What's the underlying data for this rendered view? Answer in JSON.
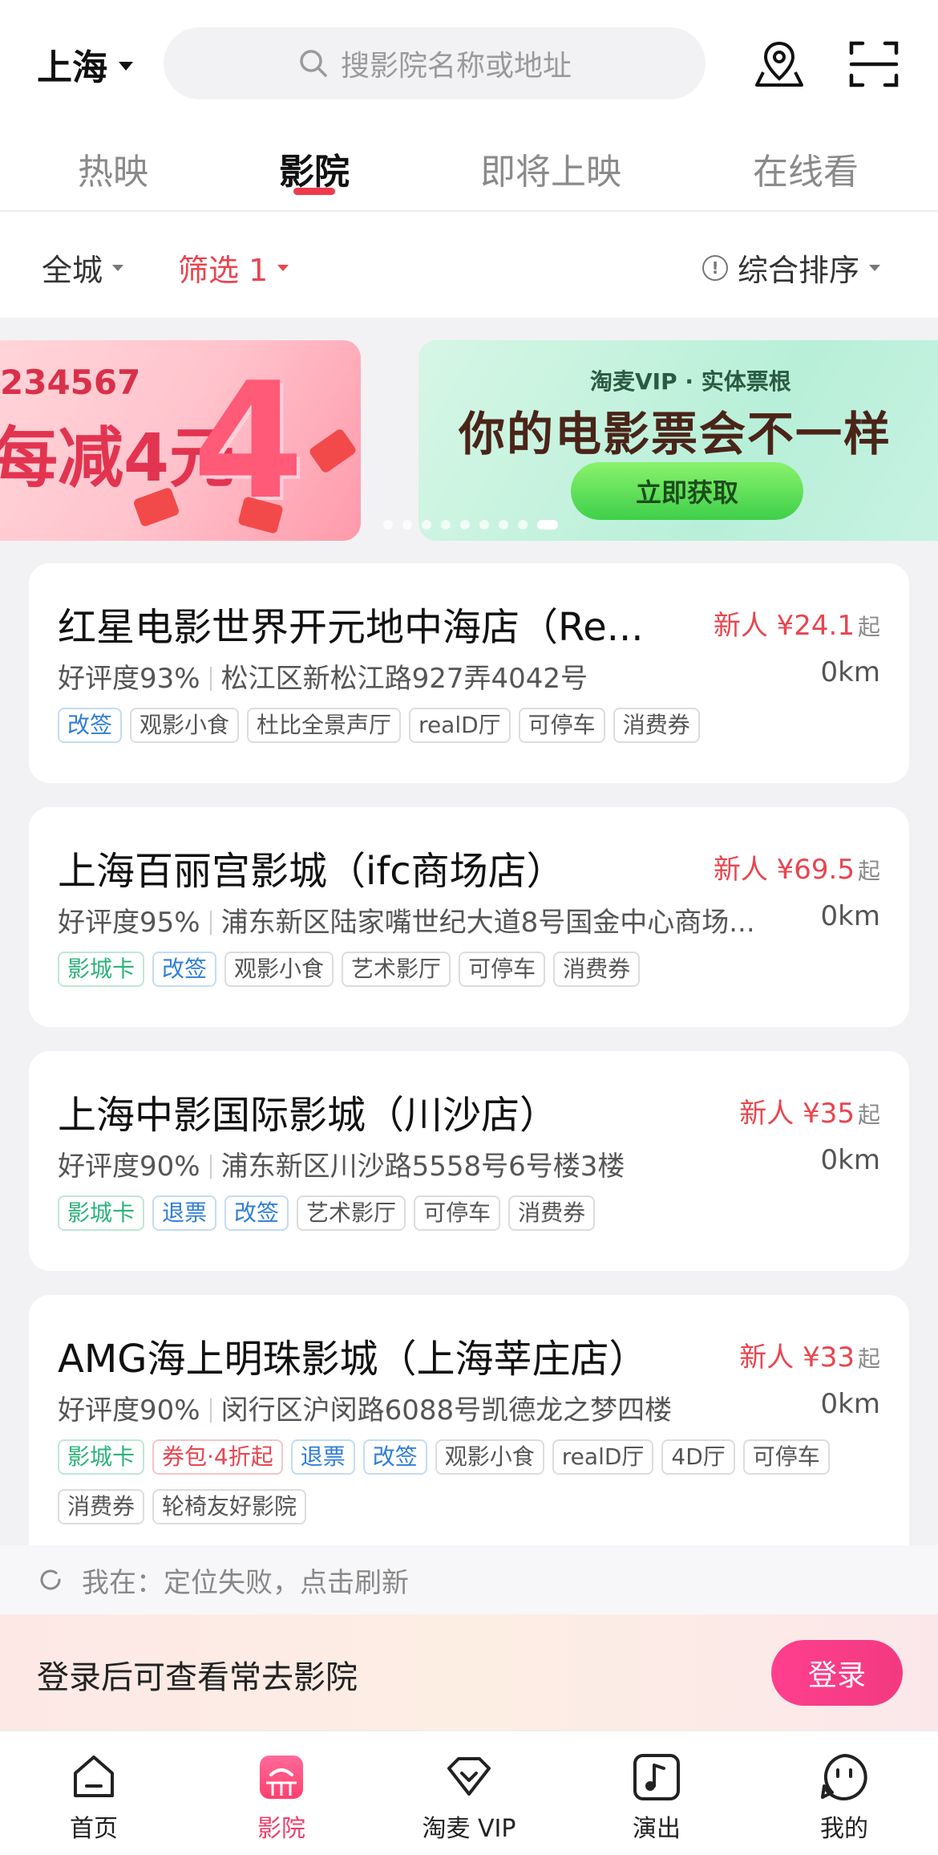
{
  "header": {
    "city": "上海",
    "search_placeholder": "搜影院名称或地址"
  },
  "tabs": [
    {
      "label": "热映",
      "active": false
    },
    {
      "label": "影院",
      "active": true
    },
    {
      "label": "即将上映",
      "active": false
    },
    {
      "label": "在线看",
      "active": false
    }
  ],
  "filters": {
    "area": "全城",
    "filter": "筛选 1",
    "sort": "综合排序"
  },
  "banners": {
    "left": {
      "number": "234567",
      "text": "每减4元",
      "big_digit": "4"
    },
    "right": {
      "subtitle": "淘麦VIP · 实体票根",
      "title": "你的电影票会不一样",
      "button": "立即获取"
    }
  },
  "cinemas": [
    {
      "name": "红星电影世界开元地中海店（Re...",
      "price_prefix": "新人 ¥24.1",
      "price_suffix": "起",
      "rating": "好评度93%",
      "address": "松江区新松江路927弄4042号",
      "distance": "0km",
      "tags": [
        {
          "text": "改签",
          "style": "blue"
        },
        {
          "text": "观影小食",
          "style": "gray"
        },
        {
          "text": "杜比全景声厅",
          "style": "gray"
        },
        {
          "text": "realD厅",
          "style": "gray"
        },
        {
          "text": "可停车",
          "style": "gray"
        },
        {
          "text": "消费券",
          "style": "gray"
        }
      ]
    },
    {
      "name": "上海百丽宫影城（ifc商场店）",
      "price_prefix": "新人 ¥69.5",
      "price_suffix": "起",
      "rating": "好评度95%",
      "address": "浦东新区陆家嘴世纪大道8号国金中心商场...",
      "distance": "0km",
      "tags": [
        {
          "text": "影城卡",
          "style": "green"
        },
        {
          "text": "改签",
          "style": "blue"
        },
        {
          "text": "观影小食",
          "style": "gray"
        },
        {
          "text": "艺术影厅",
          "style": "gray"
        },
        {
          "text": "可停车",
          "style": "gray"
        },
        {
          "text": "消费券",
          "style": "gray"
        }
      ]
    },
    {
      "name": "上海中影国际影城（川沙店）",
      "price_prefix": "新人 ¥35",
      "price_suffix": "起",
      "rating": "好评度90%",
      "address": "浦东新区川沙路5558号6号楼3楼",
      "distance": "0km",
      "tags": [
        {
          "text": "影城卡",
          "style": "green"
        },
        {
          "text": "退票",
          "style": "blue"
        },
        {
          "text": "改签",
          "style": "blue"
        },
        {
          "text": "艺术影厅",
          "style": "gray"
        },
        {
          "text": "可停车",
          "style": "gray"
        },
        {
          "text": "消费券",
          "style": "gray"
        }
      ]
    },
    {
      "name": "AMG海上明珠影城（上海莘庄店）",
      "price_prefix": "新人 ¥33",
      "price_suffix": "起",
      "rating": "好评度90%",
      "address": "闵行区沪闵路6088号凯德龙之梦四楼",
      "distance": "0km",
      "tags": [
        {
          "text": "影城卡",
          "style": "green"
        },
        {
          "text": "券包·4折起",
          "style": "red"
        },
        {
          "text": "退票",
          "style": "blue"
        },
        {
          "text": "改签",
          "style": "blue"
        },
        {
          "text": "观影小食",
          "style": "gray"
        },
        {
          "text": "realD厅",
          "style": "gray"
        },
        {
          "text": "4D厅",
          "style": "gray"
        },
        {
          "text": "可停车",
          "style": "gray"
        },
        {
          "text": "消费券",
          "style": "gray"
        },
        {
          "text": "轮椅友好影院",
          "style": "gray"
        }
      ]
    }
  ],
  "location": {
    "text": "我在：定位失败，点击刷新"
  },
  "login": {
    "prompt": "登录后可查看常去影院",
    "button": "登录"
  },
  "bottom_nav": [
    {
      "label": "首页",
      "icon": "home-icon",
      "active": false
    },
    {
      "label": "影院",
      "icon": "cinema-icon",
      "active": true
    },
    {
      "label": "淘麦 VIP",
      "icon": "vip-heart-icon",
      "active": false
    },
    {
      "label": "演出",
      "icon": "music-note-icon",
      "active": false
    },
    {
      "label": "我的",
      "icon": "profile-face-icon",
      "active": false
    }
  ],
  "colors": {
    "accent_red": "#e8454f",
    "tab_indicator": "#ef3a4d",
    "login_button": "#f23a80",
    "tag_green": "#2bb37a",
    "tag_blue": "#2f7ed8"
  }
}
